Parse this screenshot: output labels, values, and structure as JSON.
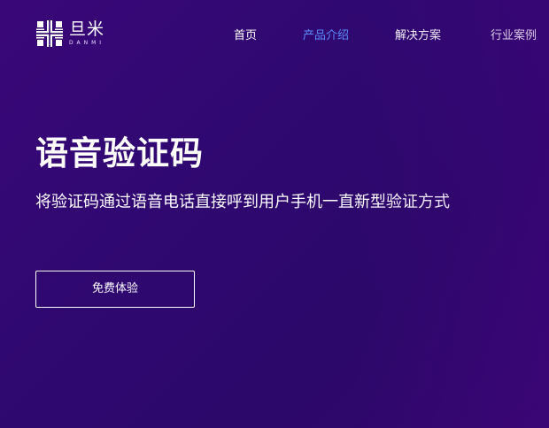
{
  "brand": {
    "name_cn": "旦米",
    "name_en": "DANMI",
    "logo_icon": "snowflake-grid-icon"
  },
  "nav": {
    "items": [
      {
        "label": "首页",
        "active": false
      },
      {
        "label": "产品介绍",
        "active": true
      },
      {
        "label": "解决方案",
        "active": false
      },
      {
        "label": "行业案例",
        "active": false
      }
    ]
  },
  "hero": {
    "title": "语音验证码",
    "subtitle": "将验证码通过语音电话直接呼到用户手机一直新型验证方式",
    "cta_label": "免费体验"
  },
  "colors": {
    "background_start": "#3a0779",
    "background_end": "#2c086a",
    "text": "#ffffff",
    "nav_active": "#5b8cff"
  }
}
